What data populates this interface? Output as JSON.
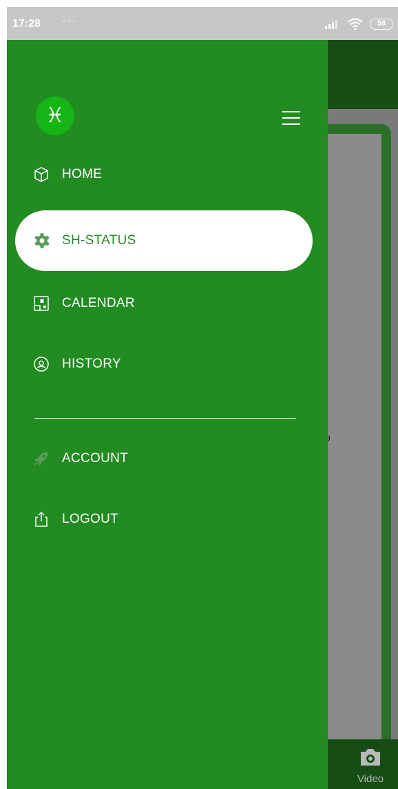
{
  "status_bar": {
    "time": "17:28",
    "dots": "···",
    "battery": "58"
  },
  "drawer": {
    "logo_glyph": "♓",
    "items": [
      {
        "label": "HOME",
        "icon": "cube-icon"
      },
      {
        "label": "SH-STATUS",
        "icon": "gear-icon",
        "active": true
      },
      {
        "label": "CALENDAR",
        "icon": "calendar-icon"
      },
      {
        "label": "HISTORY",
        "icon": "history-icon"
      },
      {
        "label": "ACCOUNT",
        "icon": "rocket-icon"
      },
      {
        "label": "LOGOUT",
        "icon": "logout-icon"
      }
    ]
  },
  "background": {
    "partial_text": "o",
    "video_label": "Video"
  },
  "colors": {
    "drawer": "#228b22",
    "header": "#154d15",
    "logo": "#14b514",
    "active_bg": "#ffffff"
  }
}
